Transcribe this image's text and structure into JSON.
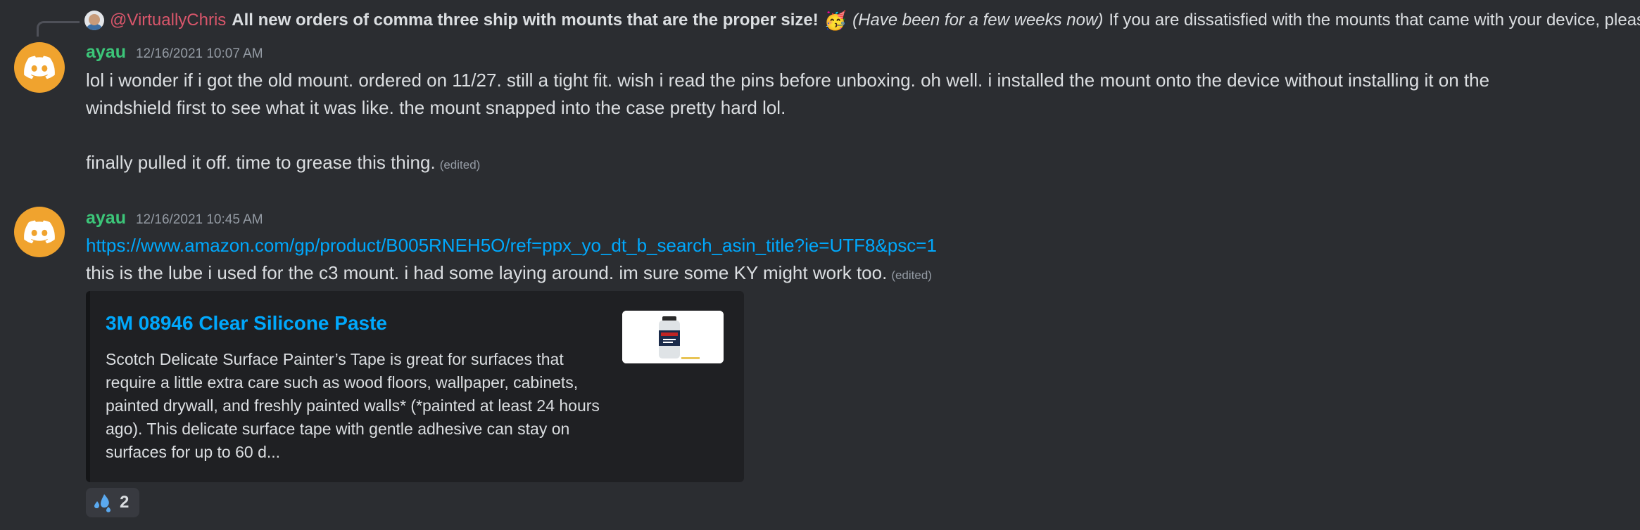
{
  "reply": {
    "author": "@VirtuallyChris",
    "bold_text": "All new orders of comma three ship with mounts that are the proper size!",
    "emoji": "🥳",
    "italic_text": "(Have been for a few weeks now)",
    "rest_text": "If you are dissatisfied with the mounts that came with your device, pleas"
  },
  "messages": [
    {
      "username": "ayau",
      "timestamp": "12/16/2021 10:07 AM",
      "line1": "lol i wonder if i got the old mount. ordered on 11/27. still a tight fit. wish i read the pins before unboxing. oh well. i installed the mount onto the device without installing it on the",
      "line2": "windshield first to see what it was like. the mount snapped into the case pretty hard lol.",
      "line3": "finally pulled it off. time to grease this thing.",
      "edited": "(edited)"
    },
    {
      "username": "ayau",
      "timestamp": "12/16/2021 10:45 AM",
      "link": "https://www.amazon.com/gp/product/B005RNEH5O/ref=ppx_yo_dt_b_search_asin_title?ie=UTF8&psc=1",
      "text": "this is the lube i used for the c3 mount. i had some laying around. im sure some KY might work too.",
      "edited": "(edited)"
    }
  ],
  "embed": {
    "title": "3M 08946 Clear Silicone Paste",
    "description": "Scotch Delicate Surface Painter’s Tape is great for surfaces that require a little extra care such as wood floors, wallpaper, cabinets, painted drywall, and freshly painted walls* (*painted at least 24 hours ago). This delicate surface tape with gentle adhesive can stay on surfaces for up to 60 d..."
  },
  "reaction": {
    "emoji": "sweat-drops-icon",
    "count": "2"
  },
  "colors": {
    "background": "#2b2d31",
    "username": "#3cc679",
    "mention": "#d9566b",
    "link": "#00a8fc",
    "avatar": "#f0a32e"
  }
}
